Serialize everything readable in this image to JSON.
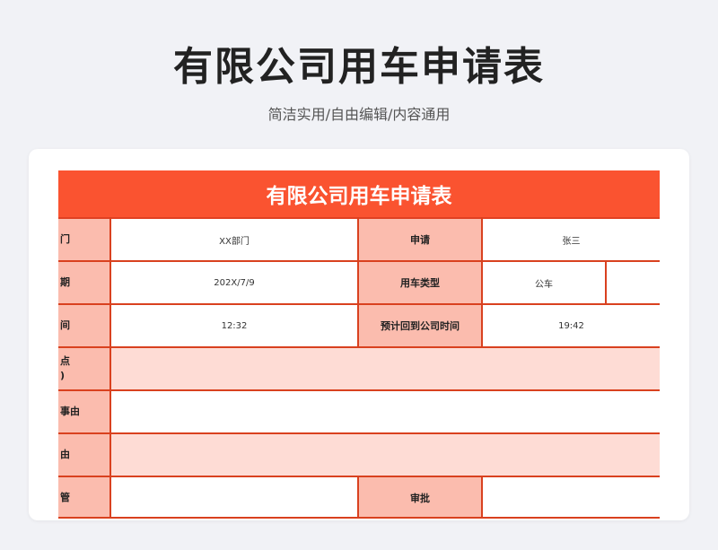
{
  "header": {
    "title": "有限公司用车申请表",
    "subtitle": "简洁实用/自由编辑/内容通用"
  },
  "form": {
    "title": "有限公司用车申请表",
    "rows": [
      {
        "label": "门",
        "value": "XX部门",
        "label2": "申请",
        "value2": "张三"
      },
      {
        "label": "期",
        "value": "202X/7/9",
        "label2": "用车类型",
        "value2": "公车",
        "value3": ""
      },
      {
        "label": "间",
        "value": "12:32",
        "label2": "预计回到公司时间",
        "value2": "19:42"
      },
      {
        "label": "点\n)",
        "value": ""
      },
      {
        "label": "事由",
        "value": ""
      },
      {
        "label": "由",
        "value": ""
      },
      {
        "label": "管",
        "value": "",
        "label2": "审批",
        "value2": ""
      }
    ]
  },
  "colors": {
    "accent": "#fa5330",
    "label_bg": "#fbbcae",
    "row_tint": "#fedcd5",
    "border": "#d9411f",
    "page_bg": "#f1f2f6"
  }
}
